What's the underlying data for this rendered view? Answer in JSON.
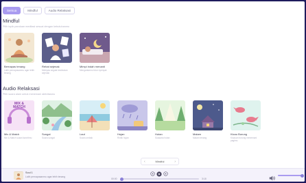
{
  "tabs": [
    {
      "label": "Semua",
      "active": true
    },
    {
      "label": "Mindful",
      "active": false
    },
    {
      "label": "Audio Relaksasi",
      "active": false
    }
  ],
  "mindful": {
    "title": "Mindful",
    "subtitle": "Pilih topik panduan meditasi sesuai dengan kebutuhanmu",
    "items": [
      {
        "title": "Bernapas tenang",
        "desc": "Latih pernapasanmu agar lebih tenang"
      },
      {
        "title": "Rehat sejenak",
        "desc": "Melepas segala kesibukan sejenak"
      },
      {
        "title": "Mimpi indah menanti",
        "desc": "Mengantarmu tidur nyenyak"
      }
    ]
  },
  "audio": {
    "title": "Audio Relaksasi",
    "subtitle": "Pilih suara alam untuk menemani aktivitasmu",
    "items": [
      {
        "title": "Mix & Match",
        "desc": "Mix & Match suara favoritmu",
        "thumb_text": "MIX & MATCH"
      },
      {
        "title": "Sungai",
        "desc": "Suara sungai"
      },
      {
        "title": "Laut",
        "desc": "Suara ombak"
      },
      {
        "title": "Hujan",
        "desc": "Rintik hujan"
      },
      {
        "title": "Hutan",
        "desc": "Suasana hutan"
      },
      {
        "title": "Malam",
        "desc": "Malam tenang"
      },
      {
        "title": "Kicau Burung",
        "desc": "Kicauan burung menemani pagimu"
      }
    ]
  },
  "pager": {
    "label": "Mindful",
    "prev": "‹",
    "next": "›"
  },
  "player": {
    "title": "Soul 1",
    "subtitle": "Latih pernapasanmu agar lebih tenang",
    "time_current": "00:00",
    "time_total": "3:18",
    "progress": 0,
    "volume": 1.0
  }
}
